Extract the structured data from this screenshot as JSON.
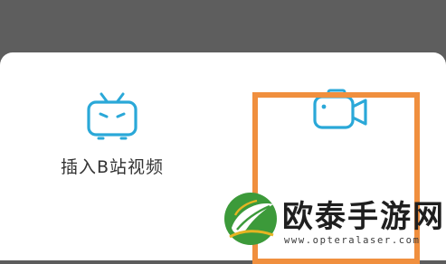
{
  "sheet": {
    "options": [
      {
        "label": "插入B站视频",
        "icon": "bilibili-tv-icon"
      },
      {
        "label": "",
        "icon": "video-camera-icon"
      }
    ],
    "highlight_color": "#f08f3e",
    "icon_color": "#2aa8d8"
  },
  "watermark": {
    "title": "欧泰手游网",
    "url": "www.opteralaser.com"
  }
}
